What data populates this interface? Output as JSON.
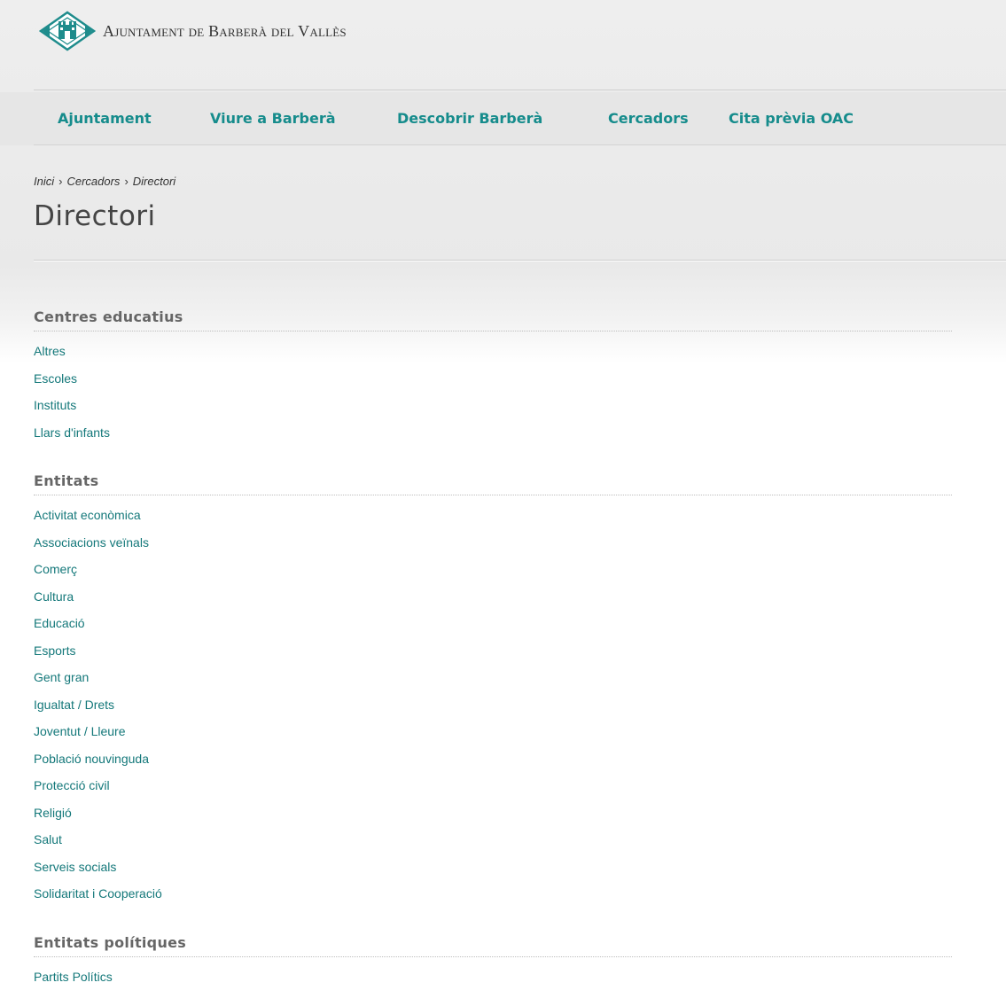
{
  "header": {
    "site_title": "Ajuntament de Barberà del Vallès"
  },
  "nav": {
    "items": [
      {
        "label": "Ajuntament"
      },
      {
        "label": "Viure a Barberà"
      },
      {
        "label": "Descobrir Barberà"
      },
      {
        "label": "Cercadors"
      },
      {
        "label": "Cita prèvia OAC"
      }
    ]
  },
  "breadcrumb": {
    "items": [
      "Inici",
      "Cercadors",
      "Directori"
    ],
    "separator": "›"
  },
  "page": {
    "title": "Directori"
  },
  "sections": [
    {
      "title": "Centres educatius",
      "items": [
        "Altres",
        "Escoles",
        "Instituts",
        "Llars d'infants"
      ]
    },
    {
      "title": "Entitats",
      "items": [
        "Activitat econòmica",
        "Associacions veïnals",
        "Comerç",
        "Cultura",
        "Educació",
        "Esports",
        "Gent gran",
        "Igualtat / Drets",
        "Joventut / Lleure",
        "Població nouvinguda",
        "Protecció civil",
        "Religió",
        "Salut",
        "Serveis socials",
        "Solidaritat i Cooperació"
      ]
    },
    {
      "title": "Entitats polítiques",
      "items": [
        "Partits Polítics"
      ]
    }
  ],
  "colors": {
    "accent": "#168c8c",
    "link": "#14787a",
    "text": "#444444"
  }
}
